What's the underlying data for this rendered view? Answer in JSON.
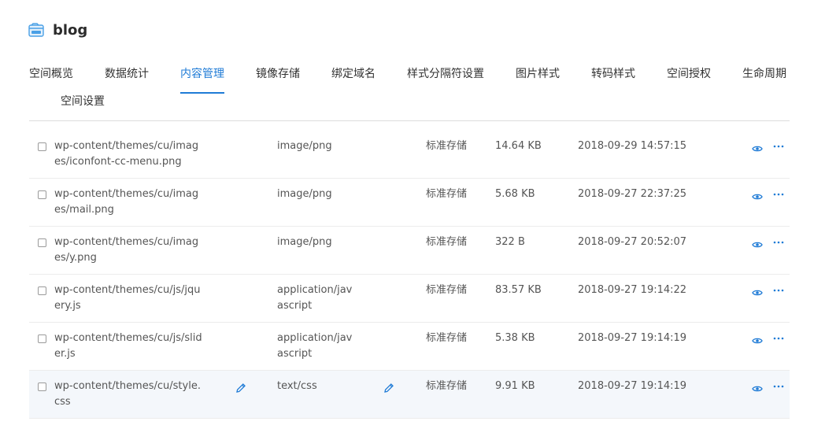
{
  "header": {
    "title": "blog",
    "icon": "bucket-icon"
  },
  "tabs": [
    {
      "label": "空间概览"
    },
    {
      "label": "数据统计"
    },
    {
      "label": "内容管理",
      "active": true
    },
    {
      "label": "镜像存储"
    },
    {
      "label": "绑定域名"
    },
    {
      "label": "样式分隔符设置"
    },
    {
      "label": "图片样式"
    },
    {
      "label": "转码样式"
    },
    {
      "label": "空间授权"
    },
    {
      "label": "生命周期"
    },
    {
      "label": "空间设置"
    }
  ],
  "files": [
    {
      "name": "wp-content/themes/cu/images/iconfont-cc-menu.png",
      "type": "image/png",
      "storage": "标准存储",
      "size": "14.64 KB",
      "date": "2018-09-29 14:57:15"
    },
    {
      "name": "wp-content/themes/cu/images/mail.png",
      "type": "image/png",
      "storage": "标准存储",
      "size": "5.68 KB",
      "date": "2018-09-27 22:37:25"
    },
    {
      "name": "wp-content/themes/cu/images/y.png",
      "type": "image/png",
      "storage": "标准存储",
      "size": "322 B",
      "date": "2018-09-27 20:52:07"
    },
    {
      "name": "wp-content/themes/cu/js/jquery.js",
      "type": "application/javascript",
      "storage": "标准存储",
      "size": "83.57 KB",
      "date": "2018-09-27 19:14:22"
    },
    {
      "name": "wp-content/themes/cu/js/slider.js",
      "type": "application/javascript",
      "storage": "标准存储",
      "size": "5.38 KB",
      "date": "2018-09-27 19:14:19"
    },
    {
      "name": "wp-content/themes/cu/style.css",
      "type": "text/css",
      "storage": "标准存储",
      "size": "9.91 KB",
      "date": "2018-09-27 19:14:19",
      "hover": true
    }
  ],
  "colors": {
    "accent": "#1f7bd6",
    "hover_row": "#f4f7fb"
  },
  "icons": {
    "view": "eye-icon",
    "more": "more-icon",
    "edit": "pencil-icon"
  }
}
